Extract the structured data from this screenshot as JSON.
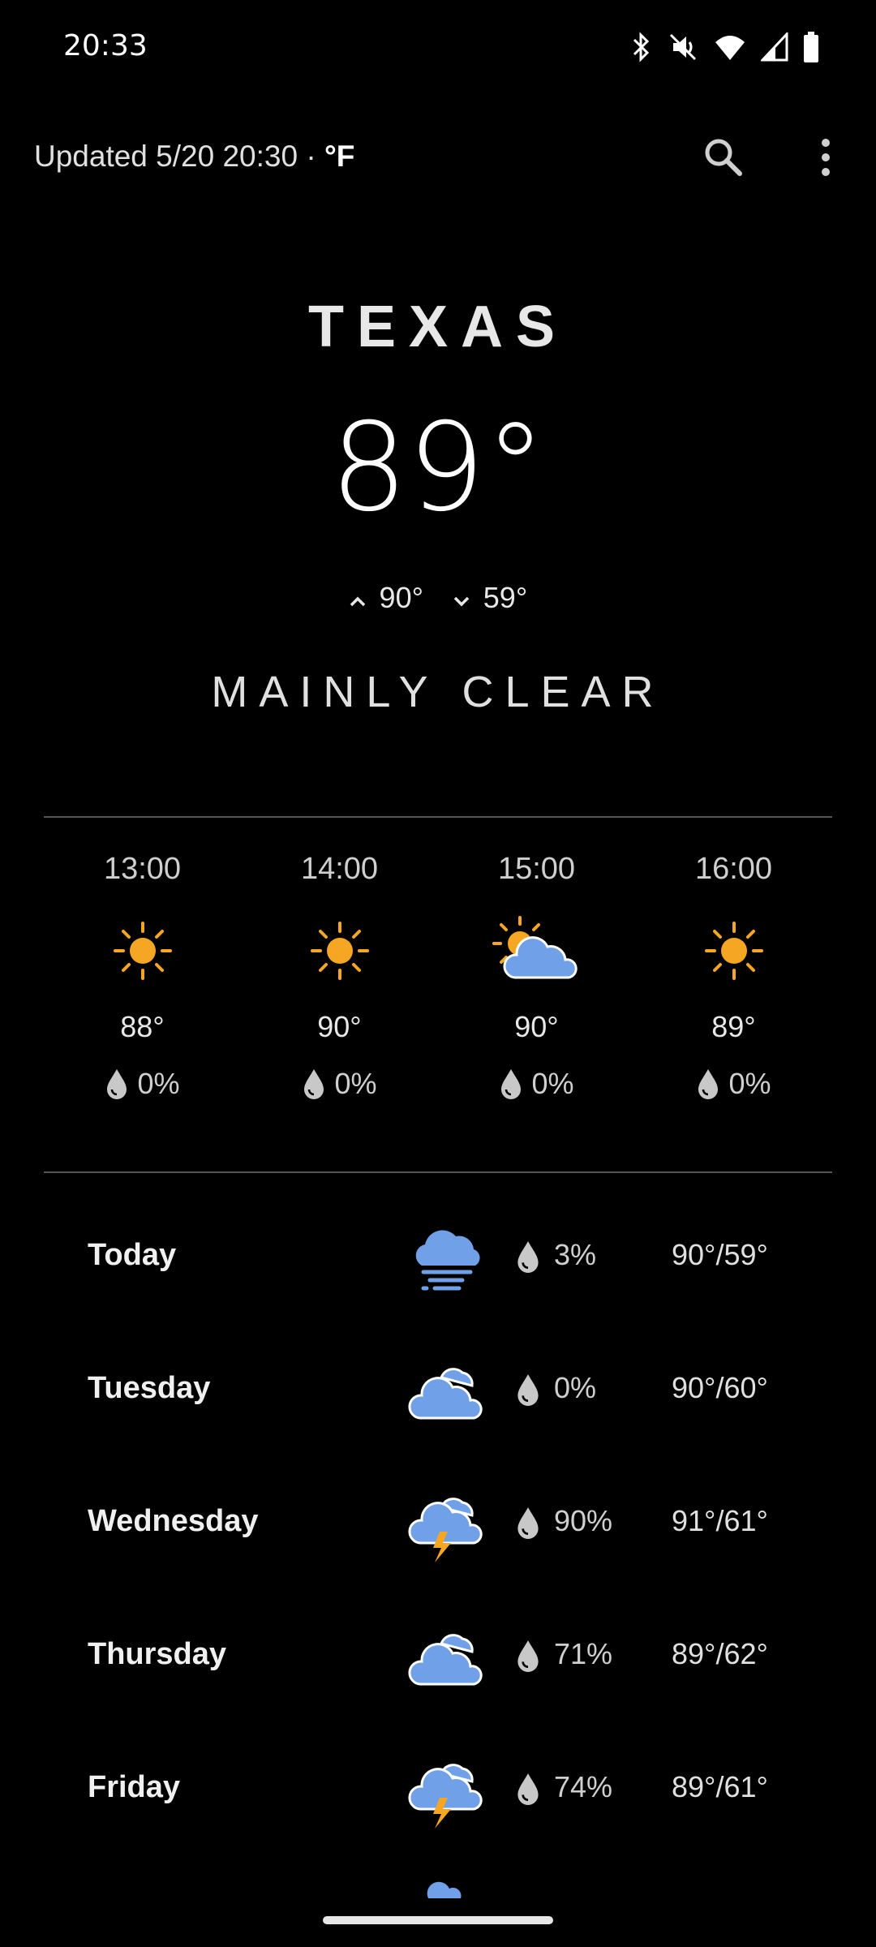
{
  "status_bar": {
    "time": "20:33",
    "icons": [
      "bluetooth-icon",
      "mute-icon",
      "wifi-icon",
      "signal-icon",
      "battery-icon"
    ]
  },
  "header": {
    "updated_label": "Updated 5/20 20:30 · ",
    "unit": "°F",
    "search_icon": "search-icon",
    "menu_icon": "more-vert-icon"
  },
  "current": {
    "city": "TEXAS",
    "temperature": "89°",
    "high": "90°",
    "low": "59°",
    "condition": "MAINLY CLEAR"
  },
  "hourly": [
    {
      "time": "13:00",
      "icon": "sun-icon",
      "temp": "88°",
      "rain": "0%"
    },
    {
      "time": "14:00",
      "icon": "sun-icon",
      "temp": "90°",
      "rain": "0%"
    },
    {
      "time": "15:00",
      "icon": "partly-cloudy-icon",
      "temp": "90°",
      "rain": "0%"
    },
    {
      "time": "16:00",
      "icon": "sun-icon",
      "temp": "89°",
      "rain": "0%"
    }
  ],
  "daily": [
    {
      "day": "Today",
      "icon": "fog-icon",
      "rain": "3%",
      "temps": "90°/59°"
    },
    {
      "day": "Tuesday",
      "icon": "cloud-icon",
      "rain": "0%",
      "temps": "90°/60°"
    },
    {
      "day": "Wednesday",
      "icon": "thunderstorm-icon",
      "rain": "90%",
      "temps": "91°/61°"
    },
    {
      "day": "Thursday",
      "icon": "cloud-icon",
      "rain": "71%",
      "temps": "89°/62°"
    },
    {
      "day": "Friday",
      "icon": "thunderstorm-icon",
      "rain": "74%",
      "temps": "89°/61°"
    }
  ],
  "colors": {
    "sun": "#F5A623",
    "cloud": "#6FA0E8",
    "bolt": "#F5A623",
    "drop": "#c8c8c8",
    "background": "#000000"
  }
}
